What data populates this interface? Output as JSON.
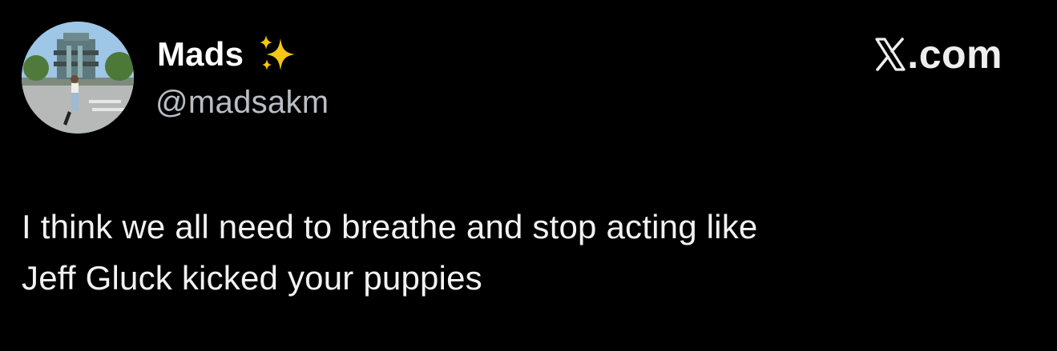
{
  "tweet": {
    "author": {
      "display_name": "Mads",
      "emoji": "sparkles-emoji",
      "handle": "@madsakm",
      "avatar": "profile-photo"
    },
    "brand": {
      "logo": "x-logo",
      "text": ".com"
    },
    "text": "I think we all need to breathe and stop acting like\nJeff Gluck kicked your puppies"
  },
  "colors": {
    "background": "#000000",
    "name": "#ffffff",
    "handle": "#b9bec4",
    "body_text": "#f2f2f2",
    "sparkle": "#f5c518"
  }
}
